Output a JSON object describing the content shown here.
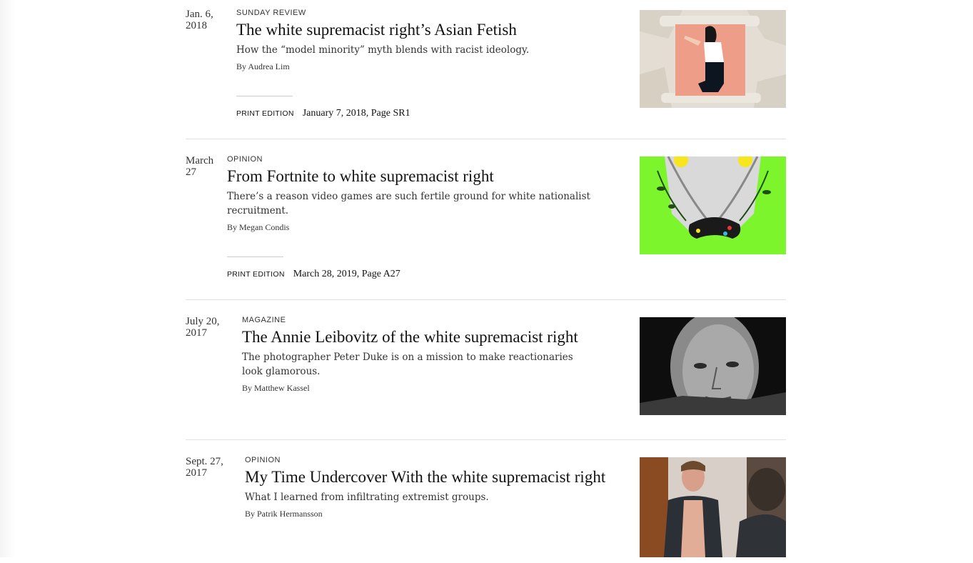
{
  "results": [
    {
      "date": [
        "Jan. 6,",
        "2018"
      ],
      "kicker": "Sunday Review",
      "headline": "The white supremacist right’s Asian Fetish",
      "summary": "How the “model minority” myth blends with racist ideology.",
      "byline": "By Audrea Lim",
      "print_label": "Print Edition",
      "print_date": "January 7, 2018, Page SR1",
      "image": "paper-scroll-woman-illustration"
    },
    {
      "date": [
        "March",
        "27"
      ],
      "kicker": "Opinion",
      "headline": "From Fortnite to white supremacist right",
      "summary": "There’s a reason video games are such fertile ground for white nationalist recruitment.",
      "byline": "By Megan Condis",
      "print_label": "Print Edition",
      "print_date": "March 28, 2019, Page A27",
      "image": "vines-game-controller-illustration"
    },
    {
      "date": [
        "July 20,",
        "2017"
      ],
      "kicker": "Magazine",
      "headline": "The Annie Leibovitz of the white supremacist right",
      "summary": "The photographer Peter Duke is on a mission to make reactionaries look glamorous.",
      "byline": "By Matthew Kassel",
      "image": "black-and-white-portrait-photo"
    },
    {
      "date": [
        "Sept. 27,",
        "2017"
      ],
      "kicker": "Opinion",
      "headline": "My Time Undercover With the white supremacist right",
      "summary": "What I learned from infiltrating extremist groups.",
      "byline": "By Patrik Hermansson",
      "image": "man-mirror-photo"
    }
  ]
}
